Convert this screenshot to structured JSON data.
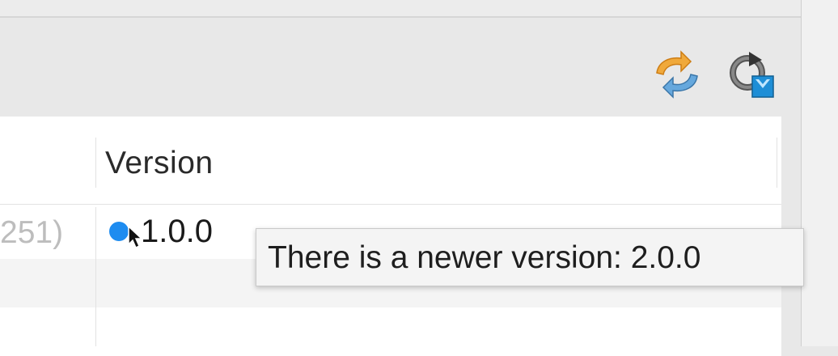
{
  "toolbar": {
    "buttons": [
      {
        "name": "sync-icon"
      },
      {
        "name": "refresh-update-icon"
      }
    ]
  },
  "table": {
    "header": {
      "version_label": "Version"
    },
    "rows": [
      {
        "prev_col_fragment": "251)",
        "version": "1.0.0",
        "status_icon": "update-available-dot",
        "status_color": "#1e8cf0"
      }
    ]
  },
  "tooltip": {
    "text": "There is a newer version: 2.0.0"
  },
  "colors": {
    "background": "#e8e8e8",
    "table_bg": "#ffffff",
    "accent_blue": "#1e8cf0",
    "icon_orange": "#f0a93b",
    "icon_light_blue": "#66a8dd"
  }
}
